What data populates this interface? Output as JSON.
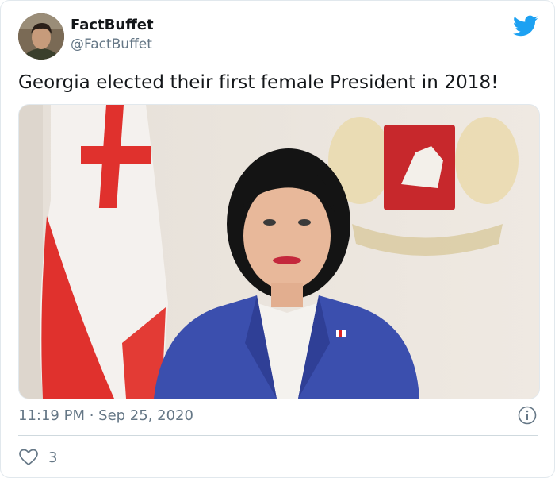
{
  "author": {
    "display_name": "FactBuffet",
    "handle": "@FactBuffet",
    "avatar_icon": "avatar-photo"
  },
  "brand": {
    "logo_icon": "twitter-bird-icon",
    "accent_color": "#1da1f2"
  },
  "tweet": {
    "text": "Georgia elected their first female President in 2018!",
    "media_alt_icon": "photo-president-with-flag-and-coat-of-arms",
    "timestamp": "11:19 PM · Sep 25, 2020"
  },
  "actions": {
    "info_icon": "info-icon",
    "like_icon": "heart-icon",
    "like_count": "3"
  }
}
